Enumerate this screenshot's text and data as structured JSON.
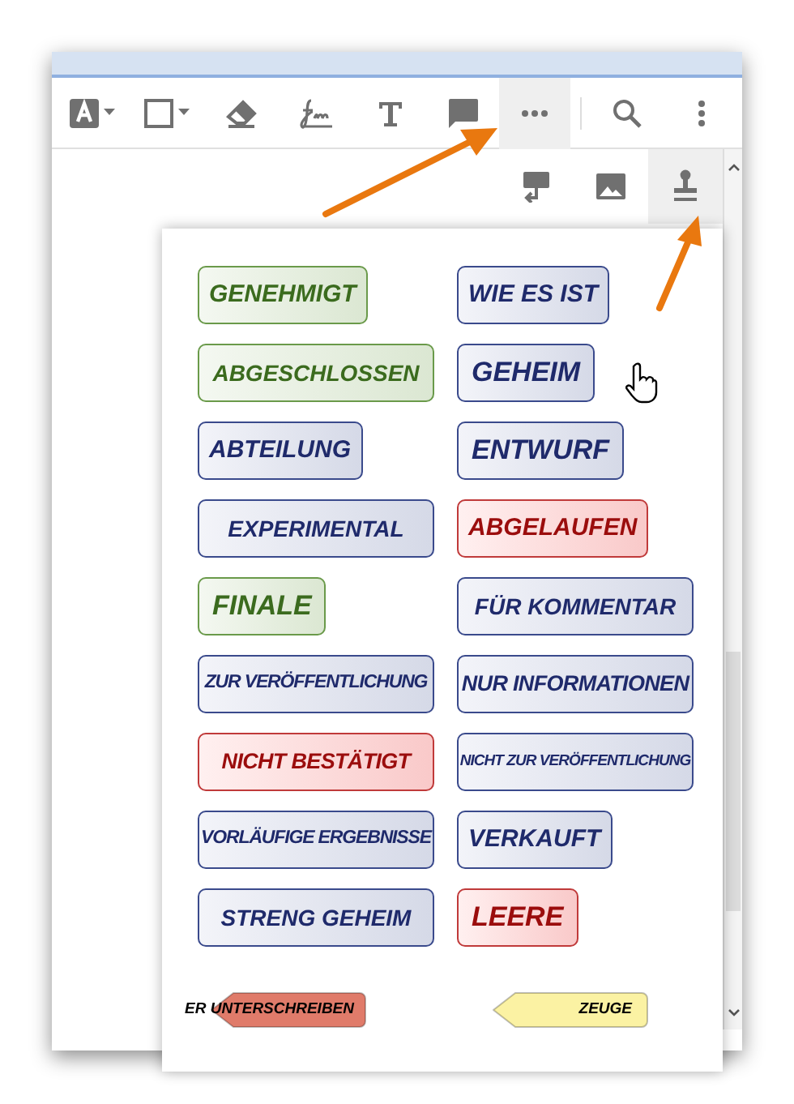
{
  "toolbar": {
    "tools": [
      {
        "kind": "font-color",
        "selected": false
      },
      {
        "kind": "shape",
        "selected": false
      },
      {
        "kind": "eraser",
        "selected": false
      },
      {
        "kind": "signature",
        "selected": false
      },
      {
        "kind": "text",
        "selected": false
      },
      {
        "kind": "comment",
        "selected": false
      },
      {
        "kind": "more",
        "selected": true
      },
      {
        "kind": "search",
        "selected": false
      },
      {
        "kind": "menu",
        "selected": false
      }
    ]
  },
  "sub_toolbar": {
    "tools": [
      {
        "kind": "callout",
        "selected": false
      },
      {
        "kind": "image",
        "selected": false
      },
      {
        "kind": "stamp",
        "selected": true
      }
    ]
  },
  "stamps": [
    {
      "text": "GENEHMIGT",
      "color": "#3b6b1e"
    },
    {
      "text": "WIE ES IST",
      "color": "#1f2a6b"
    },
    {
      "text": "ABGESCHLOSSEN",
      "color": "#3b6b1e"
    },
    {
      "text": "GEHEIM",
      "color": "#1f2a6b"
    },
    {
      "text": "ABTEILUNG",
      "color": "#1f2a6b"
    },
    {
      "text": "ENTWURF",
      "color": "#1f2a6b"
    },
    {
      "text": "EXPERIMENTAL",
      "color": "#1f2a6b"
    },
    {
      "text": "ABGELAUFEN",
      "color": "#9b0d0d"
    },
    {
      "text": "FINALE",
      "color": "#3b6b1e"
    },
    {
      "text": "FÜR KOMMENTAR",
      "color": "#1f2a6b"
    },
    {
      "text": "ZUR VERÖFFENTLICHUNG",
      "color": "#1f2a6b"
    },
    {
      "text": "NUR INFORMATIONEN",
      "color": "#1f2a6b"
    },
    {
      "text": "NICHT BESTÄTIGT",
      "color": "#9b0d0d"
    },
    {
      "text": "NICHT ZUR VERÖFFENTLICHUNG",
      "color": "#1f2a6b"
    },
    {
      "text": "VORLÄUFIGE ERGEBNISSE",
      "color": "#1f2a6b"
    },
    {
      "text": "VERKAUFT",
      "color": "#1f2a6b"
    },
    {
      "text": "STRENG GEHEIM",
      "color": "#1f2a6b"
    },
    {
      "text": "LEERE",
      "color": "#9b0d0d"
    }
  ],
  "tags": [
    {
      "text": "ER UNTERSCHREIBEN",
      "color": "#e07b6a"
    },
    {
      "text": "ZEUGE",
      "color": "#fbf2a3"
    }
  ]
}
